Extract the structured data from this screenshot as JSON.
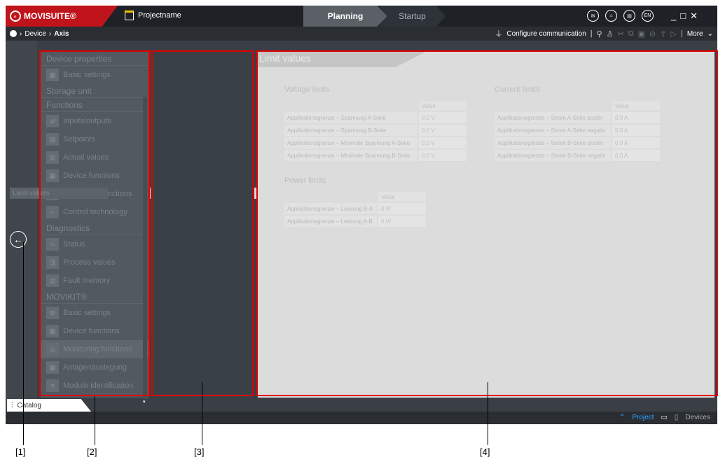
{
  "header": {
    "brand": "MOVISUITE®",
    "project_name": "Projectname",
    "tabs": [
      "Planning",
      "Startup"
    ],
    "lang_code": "EN",
    "accent_color": "#c0141c"
  },
  "breadcrumb": {
    "items": [
      "Device",
      "Axis"
    ]
  },
  "toolbar": {
    "configure_label": "Configure communication",
    "more_label": "More"
  },
  "tree": {
    "sections": [
      {
        "title": "Device properties",
        "items": [
          "Basic settings"
        ]
      },
      {
        "title": "Storage unit",
        "items": []
      },
      {
        "title": "Functions",
        "items": [
          "Inputs/outputs",
          "Setpoints",
          "Actual values",
          "Device functions",
          "Monitoring functions",
          "Control technology"
        ]
      },
      {
        "title": "Diagnostics",
        "items": [
          "Status",
          "Process values",
          "Fault memory"
        ]
      },
      {
        "title": "MOVIKIT®",
        "items": [
          "Basic settings",
          "Device functions",
          "Monitoring functions",
          "Anlagenauslegung",
          "Module identification"
        ]
      }
    ],
    "selected": "Monitoring functions"
  },
  "catalog_label": "Catalog",
  "mid_panel": {
    "items": [
      "Limit values"
    ]
  },
  "main": {
    "title": "Limit values",
    "value_header": "Value",
    "voltage": {
      "title": "Voltage limits",
      "rows": [
        {
          "label": "Applikationsgrenze – Spannung A-Seite",
          "value": "0.0 V"
        },
        {
          "label": "Applikationsgrenze – Spannung B-Seite",
          "value": "0.0 V"
        },
        {
          "label": "Applikationsgrenze – Minimale Spannung A-Seite",
          "value": "0.0 V"
        },
        {
          "label": "Applikationsgrenze – Minimale Spannung B-Seite",
          "value": "0.0 V"
        }
      ]
    },
    "current": {
      "title": "Current limits",
      "rows": [
        {
          "label": "Applikationsgrenze – Strom A-Seite positiv",
          "value": "0.0 A"
        },
        {
          "label": "Applikationsgrenze – Strom A-Seite negativ",
          "value": "0.0 A"
        },
        {
          "label": "Applikationsgrenze – Strom B-Seite positiv",
          "value": "0.0 A"
        },
        {
          "label": "Applikationsgrenze – Strom B-Seite negativ",
          "value": "0.0 A"
        }
      ]
    },
    "power": {
      "title": "Power limits",
      "rows": [
        {
          "label": "Applikationsgrenze – Leistung B-A",
          "value": "0 W"
        },
        {
          "label": "Applikationsgrenze – Leistung A-B",
          "value": "0 W"
        }
      ]
    }
  },
  "status": {
    "project_label": "Project",
    "devices_label": "Devices"
  },
  "callouts": [
    "[1]",
    "[2]",
    "[3]",
    "[4]"
  ]
}
